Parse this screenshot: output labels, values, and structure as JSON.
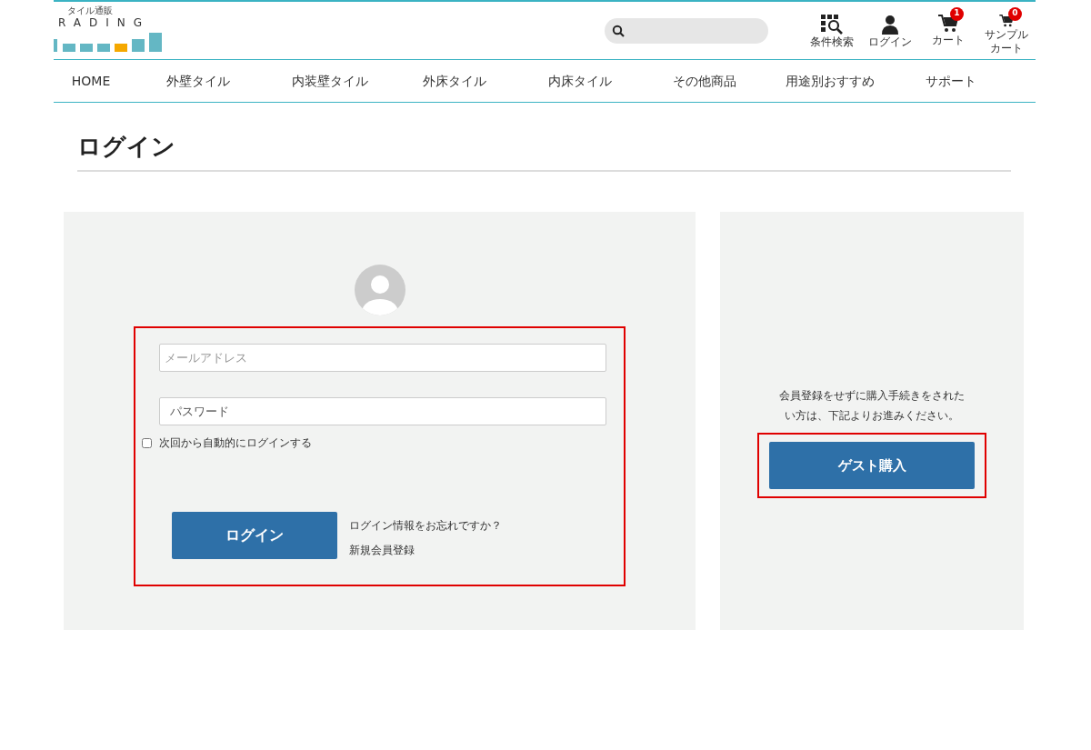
{
  "logo": {
    "tagline": "タイル通販",
    "wordmark": "RADING"
  },
  "header_icons": [
    {
      "kind": "filter",
      "label": [
        "条件検索"
      ]
    },
    {
      "kind": "user",
      "label": [
        "ログイン"
      ]
    },
    {
      "kind": "cart",
      "label": [
        "カート"
      ],
      "badge": "1"
    },
    {
      "kind": "sample-cart",
      "label": [
        "サンプル",
        "カート"
      ],
      "badge": "0"
    }
  ],
  "nav": [
    "HOME",
    "外壁タイル",
    "内装壁タイル",
    "外床タイル",
    "内床タイル",
    "その他商品",
    "用途別おすすめ",
    "サポート"
  ],
  "page_title": "ログイン",
  "login_form": {
    "highlighted": true,
    "email": {
      "placeholder": "メールアドレス"
    },
    "password": {
      "placeholder": "パスワード"
    },
    "remember": {
      "label": "次回から自動的にログインする",
      "checked": false
    },
    "submit": "ログイン",
    "links": [
      "ログイン情報をお忘れですか？",
      "新規会員登録"
    ]
  },
  "guest": {
    "highlighted": true,
    "text": [
      "会員登録をせずに購入手続きをされた",
      "い方は、下記よりお進みください。"
    ],
    "button": "ゲスト購入"
  }
}
